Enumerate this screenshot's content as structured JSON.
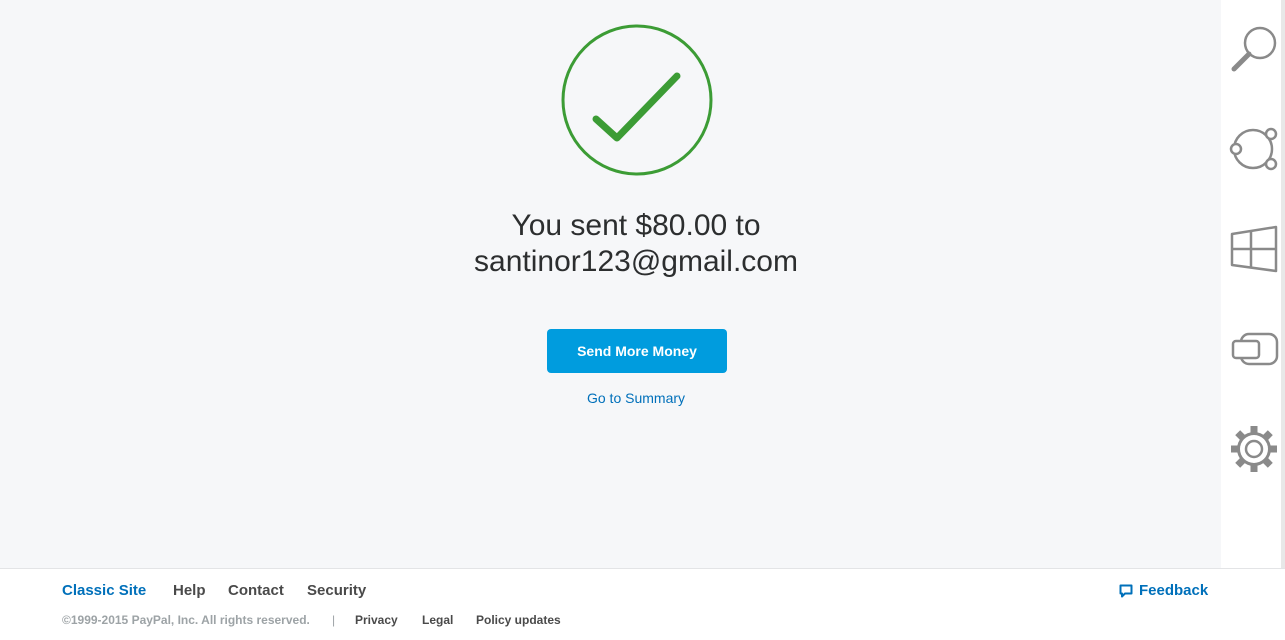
{
  "confirmation": {
    "line1": "You sent $80.00 to",
    "line2": "santinor123@gmail.com",
    "send_more_label": "Send More Money",
    "summary_link": "Go to Summary"
  },
  "charms": [
    "search-icon",
    "share-icon",
    "start-icon",
    "devices-icon",
    "settings-icon"
  ],
  "footer": {
    "classic_site": "Classic Site",
    "help": "Help",
    "contact": "Contact",
    "security": "Security",
    "feedback": "Feedback",
    "copyright": "©1999-2015 PayPal, Inc. All rights reserved.",
    "separator": "|",
    "privacy": "Privacy",
    "legal": "Legal",
    "policy_updates": "Policy updates"
  },
  "colors": {
    "success_green": "#3c9c35",
    "brand_blue": "#009cde",
    "link_blue": "#0070ba"
  }
}
